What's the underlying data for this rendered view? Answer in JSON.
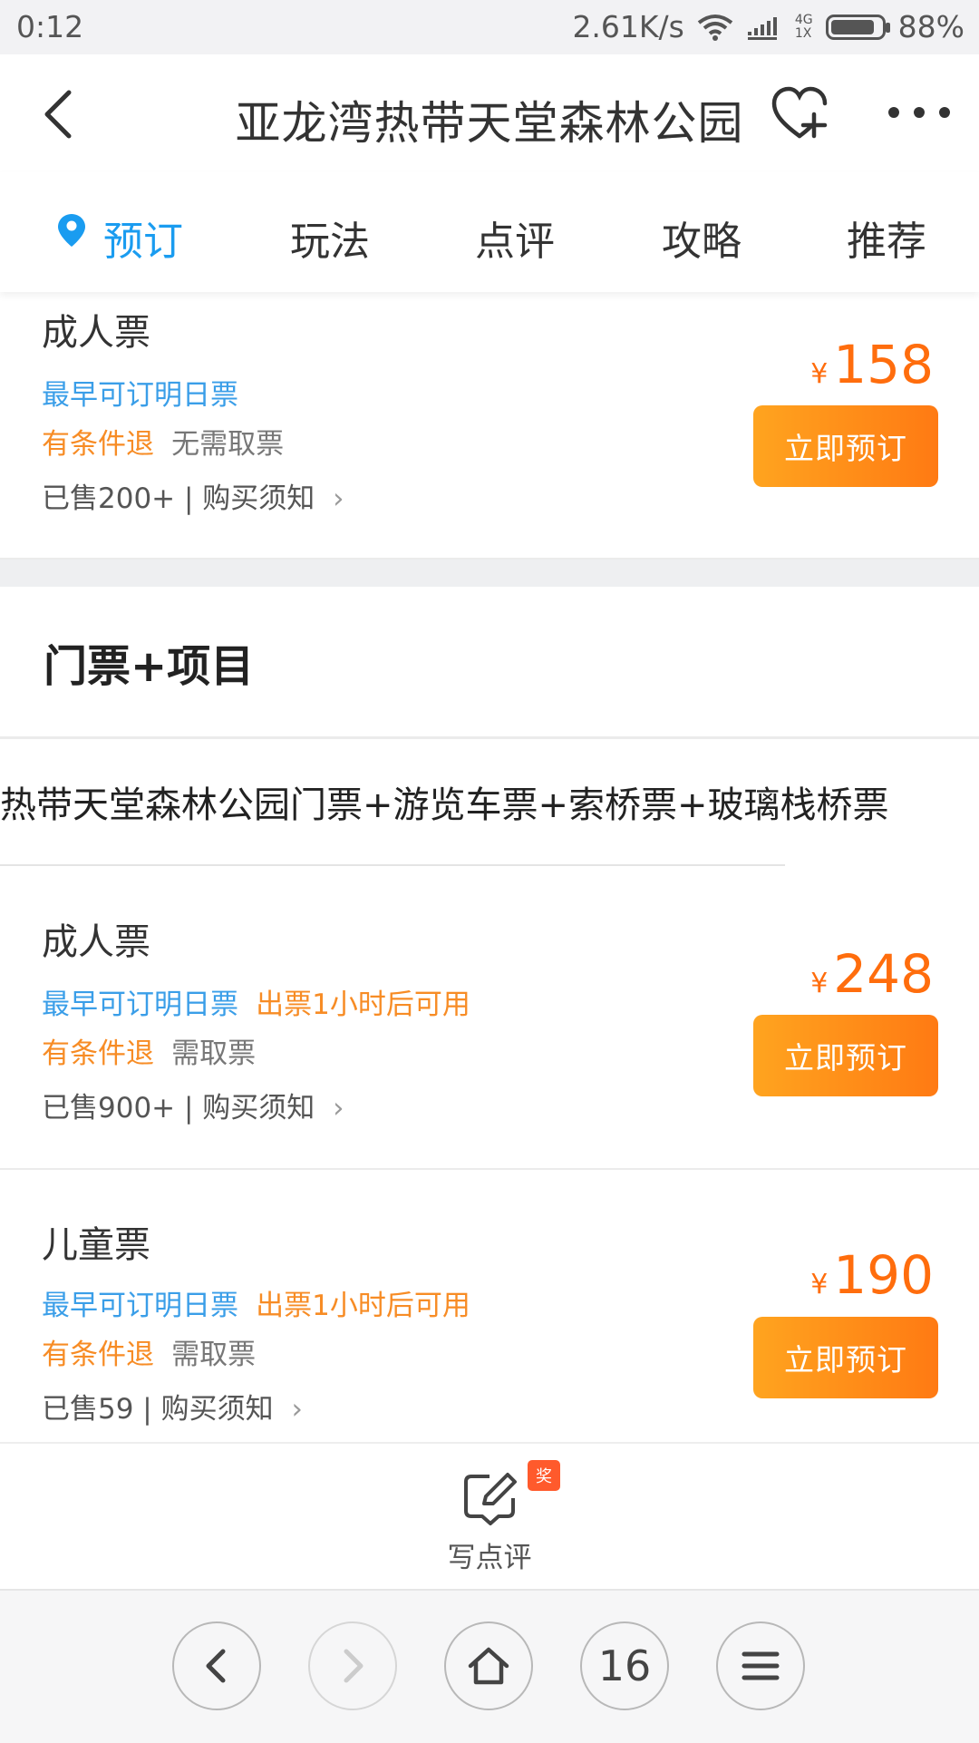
{
  "status_bar": {
    "time": "0:12",
    "speed": "2.61K/s",
    "network": "4G",
    "network_sub": "1X",
    "battery": "88%",
    "battery_level": 0.88
  },
  "header": {
    "title": "亚龙湾热带天堂森林公园"
  },
  "tabs": [
    {
      "label": "预订",
      "active": true
    },
    {
      "label": "玩法",
      "active": false
    },
    {
      "label": "点评",
      "active": false
    },
    {
      "label": "攻略",
      "active": false
    },
    {
      "label": "推荐",
      "active": false
    }
  ],
  "ticket1": {
    "name": "成人票",
    "tag1": "最早可订明日票",
    "refund": "有条件退",
    "pickup": "无需取票",
    "sold": "已售200+ | 购买须知",
    "currency": "¥",
    "price": "158",
    "button": "立即预订"
  },
  "section": {
    "title": "门票+项目"
  },
  "package": {
    "name": "热带天堂森林公园门票+游览车票+索桥票+玻璃栈桥票"
  },
  "ticket2": {
    "name": "成人票",
    "tag1": "最早可订明日票",
    "tag2": "出票1小时后可用",
    "refund": "有条件退",
    "pickup": "需取票",
    "sold": "已售900+ | 购买须知",
    "currency": "¥",
    "price": "248",
    "button": "立即预订"
  },
  "ticket3": {
    "name": "儿童票",
    "tag1": "最早可订明日票",
    "tag2": "出票1小时后可用",
    "refund": "有条件退",
    "pickup": "需取票",
    "sold": "已售59 | 购买须知",
    "currency": "¥",
    "price": "190",
    "button": "立即预订"
  },
  "write_review": {
    "label": "写点评",
    "badge": "奖"
  },
  "browser_nav": {
    "tab_count": "16"
  },
  "colors": {
    "accent": "#1a9cf0",
    "price": "#ff6d0d",
    "button_start": "#ffa41f",
    "button_end": "#ff7a13"
  }
}
